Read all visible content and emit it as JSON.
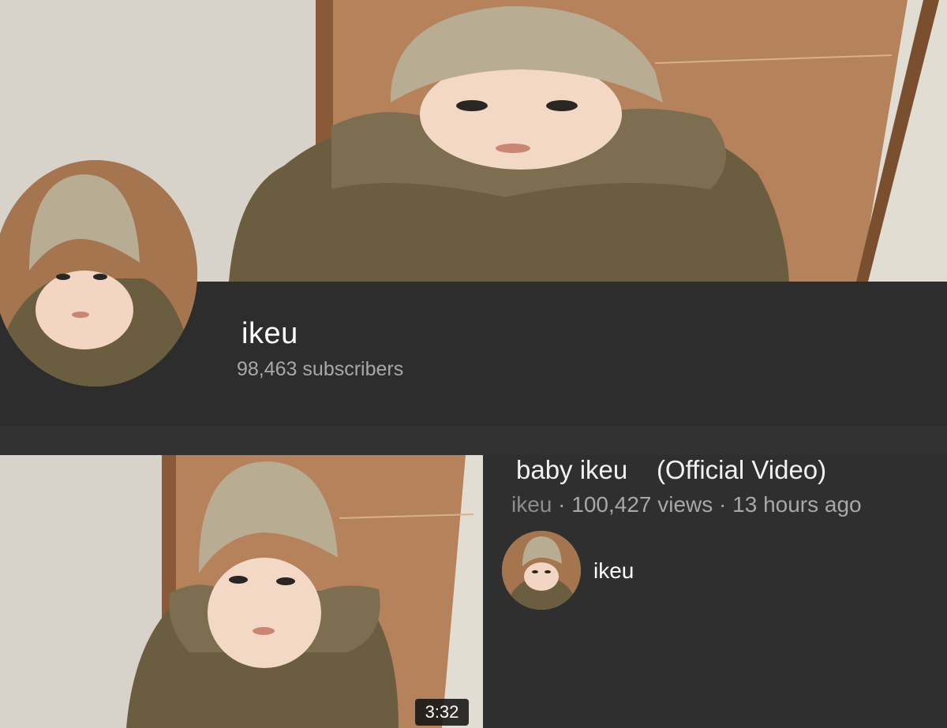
{
  "channel": {
    "name": "ikeu",
    "subscribers": "98,463 subscribers"
  },
  "video": {
    "title": "baby ikeu    (Official Video)",
    "channel": "ikeu",
    "stats": " · 100,427 views · 13 hours ago",
    "duration": "3:32"
  },
  "uploader": {
    "name": "ikeu"
  },
  "icons": [
    "channel-avatar",
    "video-thumbnail",
    "uploader-avatar"
  ],
  "colors": {
    "background": "#2f2f2f",
    "text_primary": "#ffffff",
    "text_secondary": "#a8a8a8"
  }
}
